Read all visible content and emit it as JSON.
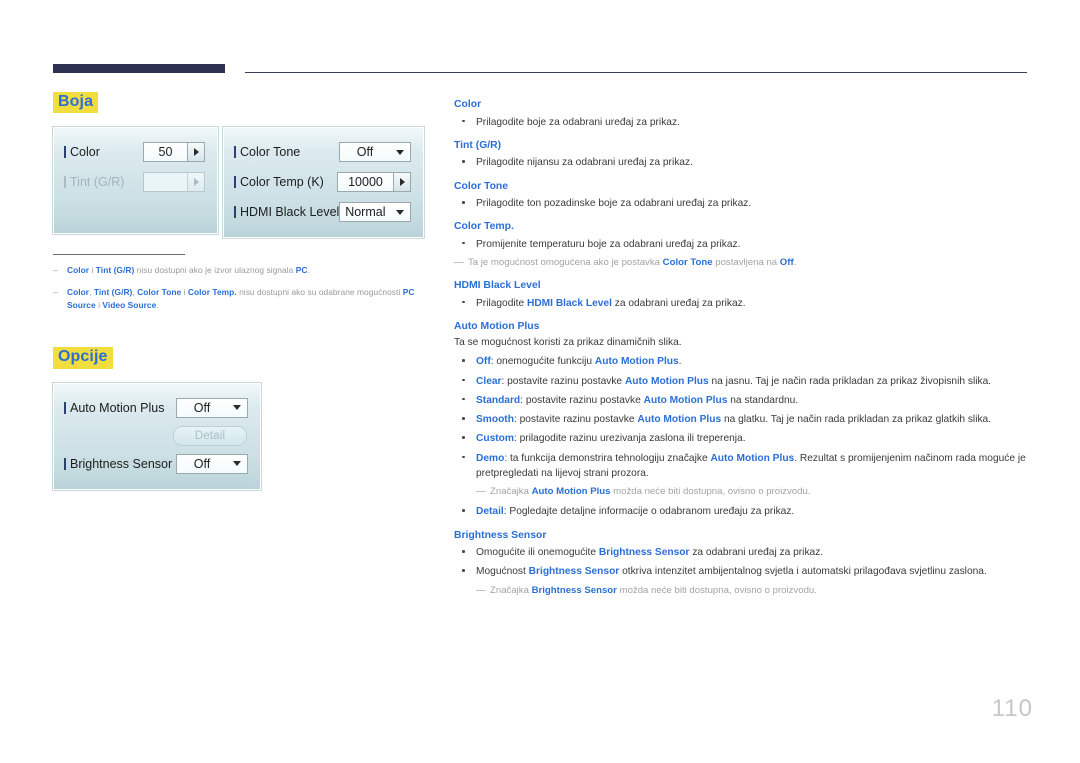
{
  "page": {
    "number": "110"
  },
  "left": {
    "section_color": {
      "heading": "Boja",
      "panel1": {
        "rows": [
          {
            "label": "Color",
            "value": "50",
            "control": "spinner",
            "disabled": false
          },
          {
            "label": "Tint (G/R)",
            "value": "",
            "control": "spinner",
            "disabled": true
          }
        ]
      },
      "panel2": {
        "rows": [
          {
            "label": "Color Tone",
            "value": "Off",
            "control": "dropdown",
            "disabled": false
          },
          {
            "label": "Color Temp (K)",
            "value": "10000",
            "control": "spinner",
            "disabled": false
          },
          {
            "label": "HDMI Black Level",
            "value": "Normal",
            "control": "dropdown",
            "disabled": false
          }
        ]
      },
      "footnotes": [
        {
          "dash": "–",
          "html": "<b>Color</b> i <b>Tint (G/R)</b> nisu dostupni ako je izvor ulaznog signala <b>PC</b>."
        },
        {
          "dash": "–",
          "html": "<b>Color</b>, <b>Tint (G/R)</b>, <b>Color Tone</b> i <b>Color Temp.</b> nisu dostupni ako su odabrane mogućnosti <b>PC Source</b> i <b>Video Source</b>."
        }
      ]
    },
    "section_options": {
      "heading": "Opcije",
      "panel": {
        "rows": [
          {
            "label": "Auto Motion Plus",
            "value": "Off",
            "control": "dropdown",
            "disabled": false
          },
          {
            "label": "Brightness Sensor",
            "value": "Off",
            "control": "dropdown",
            "disabled": false
          }
        ],
        "detail_button": "Detail"
      }
    }
  },
  "right": {
    "blocks": [
      {
        "heading": "Color",
        "items": [
          {
            "type": "bullet",
            "html": "Prilagodite boje za odabrani uređaj za prikaz."
          }
        ]
      },
      {
        "heading": "Tint (G/R)",
        "items": [
          {
            "type": "bullet",
            "html": "Prilagodite nijansu za odabrani uređaj za prikaz."
          }
        ]
      },
      {
        "heading": "Color Tone",
        "items": [
          {
            "type": "bullet",
            "html": "Prilagodite ton pozadinske boje za odabrani uređaj za prikaz."
          }
        ]
      },
      {
        "heading": "Color Temp.",
        "items": [
          {
            "type": "bullet",
            "html": "Promijenite temperaturu boje za odabrani uređaj za prikaz."
          },
          {
            "type": "note",
            "html": "Ta je mogućnost omogućena ako je postavka <b>Color Tone</b> postavljena na <b>Off</b>."
          }
        ]
      },
      {
        "heading": "HDMI Black Level",
        "items": [
          {
            "type": "bullet",
            "html": "Prilagodite <b>HDMI Black Level</b> za odabrani uređaj za prikaz."
          }
        ]
      },
      {
        "heading": "Auto Motion Plus",
        "items": [
          {
            "type": "plain",
            "html": "Ta se mogućnost koristi za prikaz dinamičnih slika."
          },
          {
            "type": "bullet",
            "html": "<b>Off</b>: onemogućite funkciju <b>Auto Motion Plus</b>."
          },
          {
            "type": "bullet",
            "html": "<b>Clear</b>: postavite razinu postavke <b>Auto Motion Plus</b> na jasnu. Taj je način rada prikladan za prikaz živopisnih slika."
          },
          {
            "type": "bullet",
            "html": "<b>Standard</b>: postavite razinu postavke <b>Auto Motion Plus</b> na standardnu."
          },
          {
            "type": "bullet",
            "html": "<b>Smooth</b>: postavite razinu postavke <b>Auto Motion Plus</b> na glatku. Taj je način rada prikladan za prikaz glatkih slika."
          },
          {
            "type": "bullet",
            "html": "<b>Custom</b>: prilagodite razinu urezivanja zaslona ili treperenja."
          },
          {
            "type": "bullet",
            "html": "<b>Demo</b>: ta funkcija demonstrira tehnologiju značajke <b>Auto Motion Plus</b>. Rezultat s promijenjenim načinom rada moguće je pretpregledati na lijevoj strani prozora."
          },
          {
            "type": "note-indent",
            "html": "Značajka <b>Auto Motion Plus</b> možda neće biti dostupna, ovisno o proizvodu."
          },
          {
            "type": "bullet",
            "html": "<b>Detail</b>: Pogledajte detaljne informacije o odabranom uređaju za prikaz."
          }
        ]
      },
      {
        "heading": "Brightness Sensor",
        "items": [
          {
            "type": "bullet",
            "html": "Omogućite ili onemogućite <b>Brightness Sensor</b> za odabrani uređaj za prikaz."
          },
          {
            "type": "bullet",
            "html": "Mogućnost <b>Brightness Sensor</b> otkriva intenzitet ambijentalnog svjetla i automatski prilagođava svjetlinu zaslona."
          },
          {
            "type": "note-indent",
            "html": "Značajka <b>Brightness Sensor</b> možda neće biti dostupna, ovisno o proizvodu."
          }
        ]
      }
    ]
  },
  "colors": {
    "accent_blue": "#2b6fd6",
    "highlight_yellow": "#f2dd3f",
    "header_navy": "#2e3150",
    "panel_blue": "#cfe2e7"
  }
}
